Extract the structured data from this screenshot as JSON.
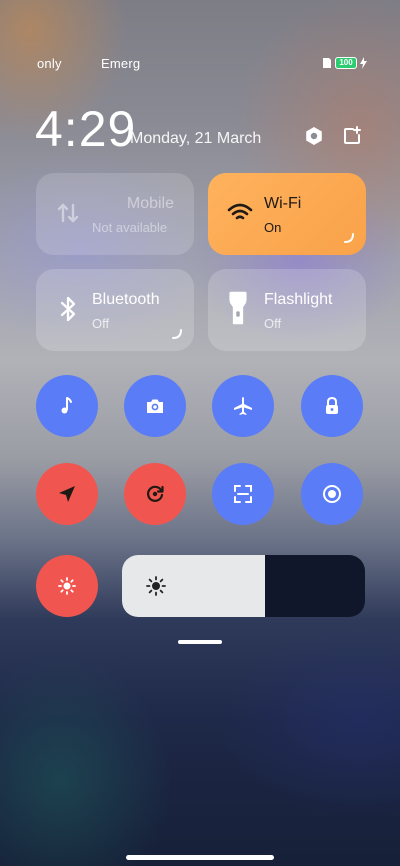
{
  "status_bar": {
    "carrier_1": "only",
    "carrier_2": "Emerg",
    "battery": "100"
  },
  "header": {
    "time": "4:29",
    "date": "Monday, 21 March"
  },
  "tiles": {
    "mobile": {
      "title": "Mobile",
      "status": "Not available"
    },
    "wifi": {
      "title": "Wi-Fi",
      "status": "On"
    },
    "bluetooth": {
      "title": "Bluetooth",
      "status": "Off"
    },
    "flashlight": {
      "title": "Flashlight",
      "status": "Off"
    }
  },
  "toggles": [
    {
      "icon": "music-note-icon",
      "color": "#5b7cf7"
    },
    {
      "icon": "camera-icon",
      "color": "#5b7cf7"
    },
    {
      "icon": "airplane-icon",
      "color": "#5b7cf7"
    },
    {
      "icon": "lock-icon",
      "color": "#5b7cf7"
    },
    {
      "icon": "location-arrow-icon",
      "color": "#f0564f"
    },
    {
      "icon": "rotation-lock-icon",
      "color": "#f0564f"
    },
    {
      "icon": "scan-icon",
      "color": "#5b7cf7"
    },
    {
      "icon": "eye-comfort-icon",
      "color": "#5b7cf7"
    },
    {
      "icon": "auto-brightness-icon",
      "color": "#f0564f"
    }
  ],
  "brightness": {
    "level": 0.59
  },
  "colors": {
    "accent_blue": "#5b7cf7",
    "accent_red": "#f0564f",
    "wifi_tile": "#ffb25c"
  }
}
